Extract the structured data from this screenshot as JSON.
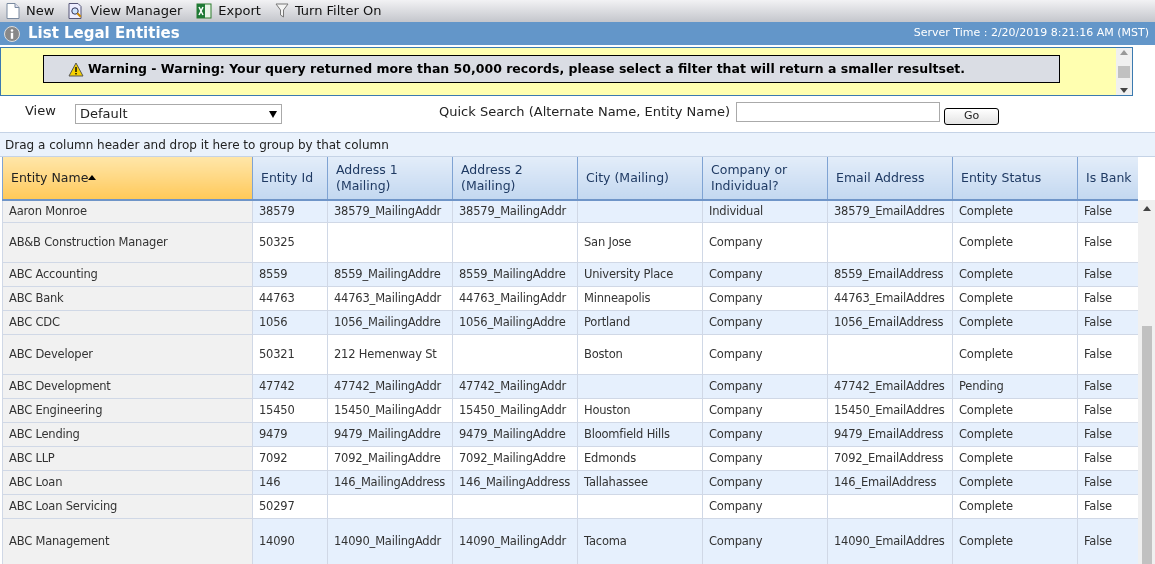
{
  "toolbar": [
    {
      "kind": "new",
      "label": "New"
    },
    {
      "kind": "views",
      "label": "View Manager"
    },
    {
      "kind": "excel",
      "label": "Export"
    },
    {
      "kind": "filter",
      "label": "Turn Filter On"
    }
  ],
  "title_bar": {
    "title": "List Legal Entities",
    "server_time": "Server Time : 2/20/2019 8:21:16 AM (MST)"
  },
  "warning": {
    "message": "Warning - Warning: Your query returned more than 50,000 records, please select a filter that will return a smaller resultset."
  },
  "filters": {
    "view_label": "View",
    "view_value": "Default",
    "search_label": "Quick Search (Alternate Name, Entity Name)",
    "go_button": "Go"
  },
  "group_panel": "Drag a column header and drop it here to group by that column",
  "table": {
    "columns": [
      {
        "label": "Entity Name",
        "sorted": true
      },
      {
        "label": "Entity Id",
        "sorted": false
      },
      {
        "label": "Address 1 (Mailing)",
        "sorted": false
      },
      {
        "label": "Address 2 (Mailing)",
        "sorted": false
      },
      {
        "label": "City (Mailing)",
        "sorted": false
      },
      {
        "label": "Company or Individual?",
        "sorted": false
      },
      {
        "label": "Email Address",
        "sorted": false
      },
      {
        "label": "Entity Status",
        "sorted": false
      },
      {
        "label": "Is Bank",
        "sorted": false
      }
    ],
    "rows": [
      [
        "Aaron Monroe",
        "38579",
        "38579_MailingAddr",
        "38579_MailingAddr",
        null,
        "Individual",
        "38579_EmailAddres",
        "Complete",
        "False"
      ],
      [
        "AB&B Construction Manager",
        "50325",
        null,
        null,
        "San Jose",
        "Company",
        null,
        "Complete",
        "False"
      ],
      [
        "ABC Accounting",
        "8559",
        "8559_MailingAddre",
        "8559_MailingAddre",
        "University Place",
        "Company",
        "8559_EmailAddress",
        "Complete",
        "False"
      ],
      [
        "ABC Bank",
        "44763",
        "44763_MailingAddr",
        "44763_MailingAddr",
        "Minneapolis",
        "Company",
        "44763_EmailAddres",
        "Complete",
        "False"
      ],
      [
        "ABC CDC",
        "1056",
        "1056_MailingAddre",
        "1056_MailingAddre",
        "Portland",
        "Company",
        "1056_EmailAddress",
        "Complete",
        "False"
      ],
      [
        "ABC Developer",
        "50321",
        "212 Hemenway St",
        null,
        "Boston",
        "Company",
        null,
        "Complete",
        "False"
      ],
      [
        "ABC Development",
        "47742",
        "47742_MailingAddr",
        "47742_MailingAddr",
        null,
        "Company",
        "47742_EmailAddres",
        "Pending",
        "False"
      ],
      [
        "ABC Engineering",
        "15450",
        "15450_MailingAddr",
        "15450_MailingAddr",
        "Houston",
        "Company",
        "15450_EmailAddres",
        "Complete",
        "False"
      ],
      [
        "ABC Lending",
        "9479",
        "9479_MailingAddre",
        "9479_MailingAddre",
        "Bloomfield Hills",
        "Company",
        "9479_EmailAddress",
        "Complete",
        "False"
      ],
      [
        "ABC LLP",
        "7092",
        "7092_MailingAddre",
        "7092_MailingAddre",
        "Edmonds",
        "Company",
        "7092_EmailAddress",
        "Complete",
        "False"
      ],
      [
        "ABC Loan",
        "146",
        "146_MailingAddress",
        "146_MailingAddress",
        "Tallahassee",
        "Company",
        "146_EmailAddress",
        "Complete",
        "False"
      ],
      [
        "ABC Loan Servicing",
        "50297",
        null,
        null,
        null,
        "Company",
        null,
        "Complete",
        "False"
      ],
      [
        "ABC Management",
        "14090",
        "14090_MailingAddr",
        "14090_MailingAddr",
        "Tacoma",
        "Company",
        "14090_EmailAddres",
        "Complete",
        "False"
      ]
    ]
  }
}
